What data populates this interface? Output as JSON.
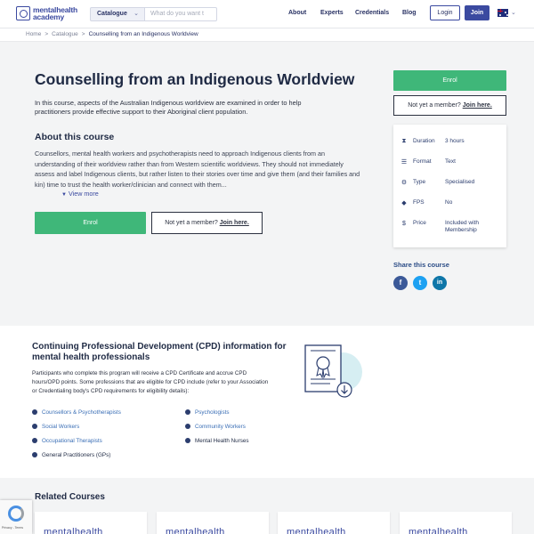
{
  "header": {
    "logo_line1": "mentalhealth",
    "logo_line2": "academy",
    "catalogue_label": "Catalogue",
    "search_placeholder": "What do you want t",
    "nav": [
      "About",
      "Experts",
      "Credentials",
      "Blog"
    ],
    "login_label": "Login",
    "join_label": "Join"
  },
  "breadcrumb": {
    "home": "Home",
    "catalogue": "Catalogue",
    "current": "Counselling from an Indigenous Worldview",
    "separator": ">"
  },
  "course": {
    "title": "Counselling from an Indigenous Worldview",
    "intro": "In this course, aspects of the Australian Indigenous worldview are examined in order to help practitioners provide effective support to their Aboriginal client population.",
    "about_heading": "About this course",
    "description": "Counsellors, mental health workers and psychotherapists need to approach Indigenous clients from an understanding of their worldview rather than from Western scientific worldviews. They should not immediately assess and label Indigenous clients, but rather listen to their stories over time and give them (and their families and kin) time to trust the health worker/clinician and connect with them...",
    "view_more": "View more",
    "enrol_label": "Enrol",
    "not_member_text": "Not yet a member?",
    "join_here": "Join here",
    "join_here_main": "Join here."
  },
  "sidebar": {
    "enrol_label": "Enrol",
    "not_member_text": "Not yet a member?",
    "join_here": "Join here.",
    "details": [
      {
        "icon": "hourglass-icon",
        "label": "Duration",
        "value": "3 hours"
      },
      {
        "icon": "format-icon",
        "label": "Format",
        "value": "Text"
      },
      {
        "icon": "type-icon",
        "label": "Type",
        "value": "Specialised"
      },
      {
        "icon": "fps-icon",
        "label": "FPS",
        "value": "No"
      },
      {
        "icon": "price-icon",
        "label": "Price",
        "value": "Included with Membership"
      }
    ],
    "share_heading": "Share this course",
    "social": [
      {
        "name": "facebook",
        "glyph": "f",
        "color": "#3b5998"
      },
      {
        "name": "twitter",
        "glyph": "t",
        "color": "#1da1f2"
      },
      {
        "name": "linkedin",
        "glyph": "in",
        "color": "#0e76a8"
      }
    ]
  },
  "cpd": {
    "heading": "Continuing Professional Development (CPD) information for mental health professionals",
    "paragraph": "Participants who complete this program will receive a CPD Certificate and accrue CPD hours/OPD points. Some professions that are eligible for CPD include (refer to your Association or Credentialing body's CPD requirements for eligibility details):",
    "professions": [
      "Counsellors & Psychotherapists",
      "Psychologists",
      "Social Workers",
      "Community Workers",
      "Occupational Therapists",
      "Mental Health Nurses",
      "General Practitioners (GPs)"
    ]
  },
  "related": {
    "heading": "Related Courses",
    "card_text": "mentalhealth"
  },
  "recaptcha": {
    "text": "Privacy - Terms"
  },
  "colors": {
    "brand": "#3b4aa0",
    "enrol_green": "#3fb779",
    "hero_bg": "#f3f4f5",
    "link": "#3b6fb6"
  }
}
